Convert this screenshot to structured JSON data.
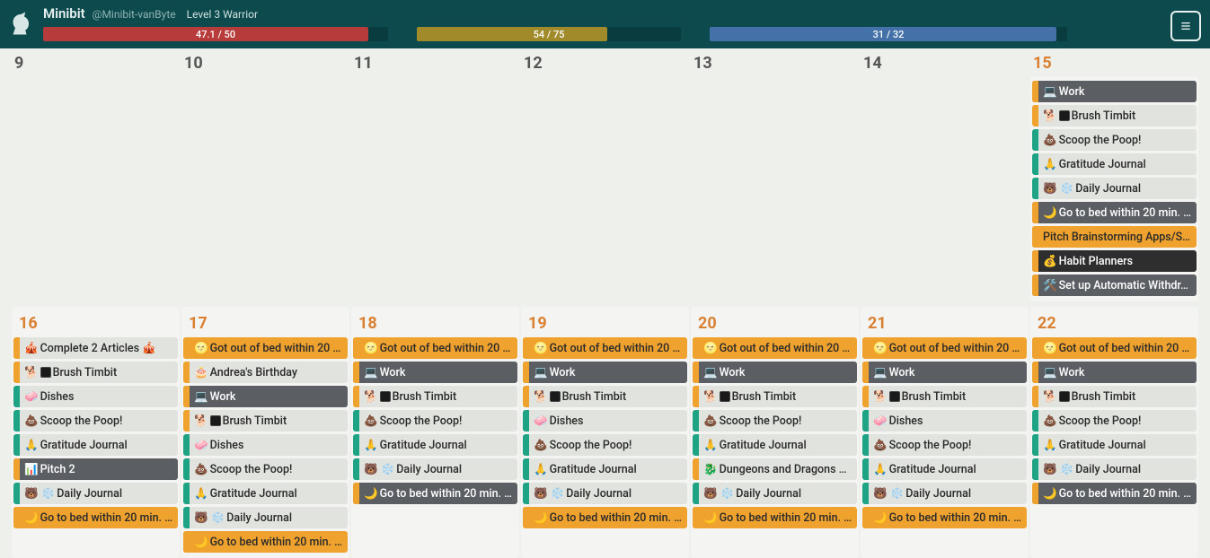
{
  "header": {
    "display_name": "Minibit",
    "handle": "@Minibit-vanByte",
    "level_text": "Level 3 Warrior",
    "bars": {
      "health": {
        "label": "47.1 / 50",
        "pct": 94.2
      },
      "xp": {
        "label": "54 / 75",
        "pct": 72.0
      },
      "mp": {
        "label": "31 / 32",
        "pct": 96.9
      }
    }
  },
  "week1_days": [
    "9",
    "10",
    "11",
    "12",
    "13",
    "14",
    "15"
  ],
  "week2_days": [
    "16",
    "17",
    "18",
    "19",
    "20",
    "21",
    "22"
  ],
  "tasks_common": {
    "work": {
      "text": "Work",
      "emoji": "💻",
      "stripe": "orange",
      "body": "gray"
    },
    "brush": {
      "text": "Brush Timbit",
      "emoji": "🐕",
      "black_sq": true,
      "stripe": "orange",
      "body": "light"
    },
    "scoop": {
      "text": "Scoop the Poop!",
      "emoji": "💩",
      "stripe": "teal",
      "body": "light"
    },
    "gratitude": {
      "text": "Gratitude Journal",
      "emoji": "🙏",
      "stripe": "teal",
      "body": "light"
    },
    "daily_journal": {
      "text": "Daily Journal",
      "emoji": "🐻 ❄️",
      "stripe": "teal",
      "body": "light"
    },
    "gobed": {
      "text": "Go to bed within 20 min. …",
      "emoji": "🌙",
      "stripe": "orange",
      "body": "gray"
    },
    "gobed_orange": {
      "text": "Go to bed within 20 min. …",
      "emoji": "🌙",
      "stripe": "orange",
      "body": "orange"
    },
    "gotout": {
      "text": "Got out of bed within 20 …",
      "emoji": "🌝",
      "stripe": "orange",
      "body": "orange"
    },
    "dishes": {
      "text": "Dishes",
      "emoji": "🧼",
      "stripe": "teal",
      "body": "light"
    },
    "pitch_brain": {
      "text": "Pitch Brainstorming Apps/S…",
      "emoji": "",
      "stripe": "orange",
      "body": "orange"
    },
    "habit_plan": {
      "text": "Habit Planners",
      "emoji": "💰",
      "stripe": "orange",
      "body": "dark"
    },
    "auto_with": {
      "text": "Set up Automatic Withdr…",
      "emoji": "🛠️",
      "stripe": "orange",
      "body": "gray"
    },
    "articles": {
      "text": "Complete 2 Articles 🎪",
      "emoji": "🎪",
      "stripe": "orange",
      "body": "light"
    },
    "pitch2": {
      "text": "Pitch 2",
      "emoji": "📊",
      "stripe": "orange",
      "body": "gray"
    },
    "birthday": {
      "text": "Andrea's Birthday",
      "emoji": "🎂",
      "stripe": "orange",
      "body": "light"
    },
    "dnd": {
      "text": "Dungeons and Dragons …",
      "emoji": "🐉",
      "stripe": "orange",
      "body": "light"
    }
  },
  "day15": [
    "work",
    "brush",
    "scoop",
    "gratitude",
    "daily_journal",
    "gobed",
    "pitch_brain",
    "habit_plan",
    "auto_with"
  ],
  "day16": [
    "articles",
    "brush",
    "dishes",
    "scoop",
    "gratitude",
    "pitch2",
    "daily_journal",
    "gobed_orange"
  ],
  "day17": [
    "gotout",
    "birthday",
    "work",
    "brush",
    "dishes",
    "scoop",
    "gratitude",
    "daily_journal",
    "gobed_orange"
  ],
  "day18": [
    "gotout",
    "work",
    "brush",
    "scoop",
    "gratitude",
    "daily_journal",
    "gobed"
  ],
  "day19": [
    "gotout",
    "work",
    "brush",
    "dishes",
    "scoop",
    "gratitude",
    "daily_journal",
    "gobed_orange"
  ],
  "day20": [
    "gotout",
    "work",
    "brush",
    "scoop",
    "gratitude",
    "dnd",
    "daily_journal",
    "gobed_orange"
  ],
  "day21": [
    "gotout",
    "work",
    "brush",
    "dishes",
    "scoop",
    "gratitude",
    "daily_journal",
    "gobed_orange"
  ],
  "day22": [
    "gotout",
    "work",
    "brush",
    "scoop",
    "gratitude",
    "daily_journal",
    "gobed"
  ]
}
